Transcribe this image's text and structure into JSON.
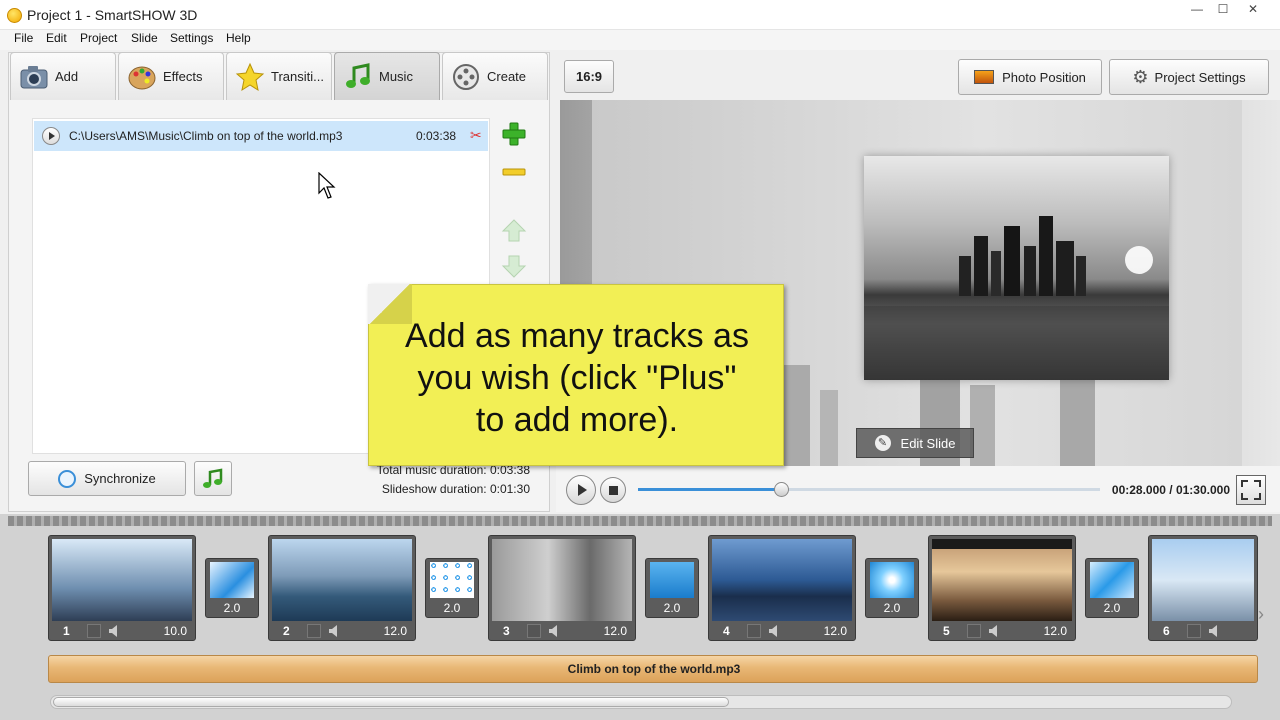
{
  "window": {
    "title": "Project 1 - SmartSHOW 3D",
    "min": "—",
    "max": "☐",
    "close": "✕"
  },
  "menu": [
    "File",
    "Edit",
    "Project",
    "Slide",
    "Settings",
    "Help"
  ],
  "tabs": [
    {
      "label": "Add",
      "icon": "camera-icon"
    },
    {
      "label": "Effects",
      "icon": "palette-icon"
    },
    {
      "label": "Transiti...",
      "icon": "star-icon"
    },
    {
      "label": "Music",
      "icon": "music-note-icon"
    },
    {
      "label": "Create",
      "icon": "film-reel-icon"
    }
  ],
  "music": {
    "track_path": "C:\\Users\\AMS\\Music\\Climb on top of the world.mp3",
    "track_duration": "0:03:38",
    "synchronize_label": "Synchronize",
    "total_music_duration": "Total music duration: 0:03:38",
    "slideshow_duration": "Slideshow duration: 0:01:30"
  },
  "preview": {
    "aspect_ratio": "16:9",
    "photo_position_label": "Photo Position",
    "project_settings_label": "Project Settings",
    "edit_slide_label": "Edit Slide",
    "time_readout": "00:28.000 / 01:30.000",
    "progress_fraction": 0.31
  },
  "callout": {
    "lines": [
      "Add as many tracks as",
      "you wish (click \"Plus\"",
      "to add more)."
    ]
  },
  "timeline": {
    "slides": [
      {
        "num": "1",
        "duration": "10.0"
      },
      {
        "num": "2",
        "duration": "12.0"
      },
      {
        "num": "3",
        "duration": "12.0"
      },
      {
        "num": "4",
        "duration": "12.0"
      },
      {
        "num": "5",
        "duration": "12.0"
      },
      {
        "num": "6",
        "duration": ""
      }
    ],
    "transitions": [
      "2.0",
      "2.0",
      "2.0",
      "2.0",
      "2.0"
    ],
    "music_track_label": "Climb on top of the world.mp3"
  },
  "colors": {
    "accent_blue": "#3a8fd8",
    "callout_yellow": "#f2ef55",
    "music_bar": "#e8b775",
    "selection": "#cde6fb"
  }
}
